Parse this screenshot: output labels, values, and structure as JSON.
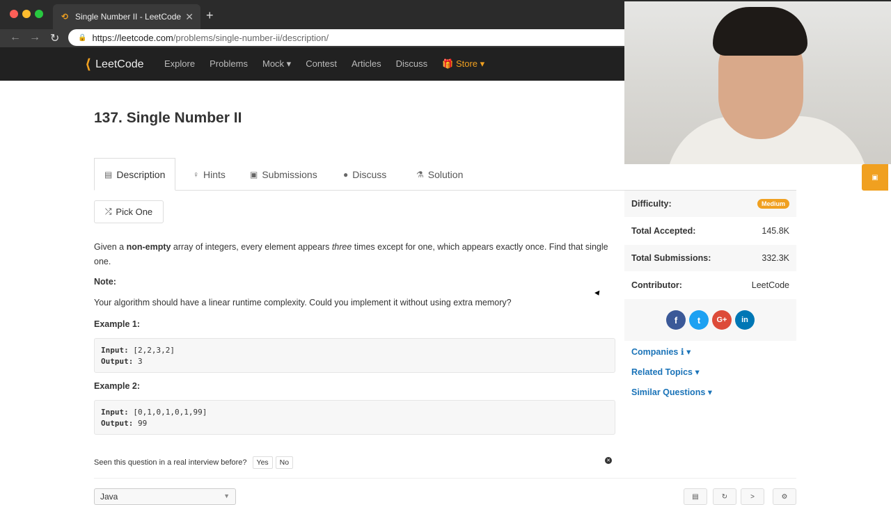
{
  "browser": {
    "tab_title": "Single Number II - LeetCode",
    "url_host": "https://leetcode.com",
    "url_path": "/problems/single-number-ii/description/"
  },
  "site_nav": {
    "logo": "LeetCode",
    "items": [
      {
        "label": "Explore"
      },
      {
        "label": "Problems"
      },
      {
        "label": "Mock ▾"
      },
      {
        "label": "Contest"
      },
      {
        "label": "Articles"
      },
      {
        "label": "Discuss"
      }
    ],
    "store_label": "🎁 Store ▾"
  },
  "problem": {
    "title": "137. Single Number II",
    "tabs": [
      {
        "label": "Description",
        "icon": "description-icon"
      },
      {
        "label": "Hints",
        "icon": "lightbulb-icon"
      },
      {
        "label": "Submissions",
        "icon": "submissions-icon"
      },
      {
        "label": "Discuss",
        "icon": "discuss-icon"
      },
      {
        "label": "Solution",
        "icon": "flask-icon"
      }
    ],
    "pick_one": "Pick One",
    "desc_1": "Given a ",
    "desc_bold": "non-empty",
    "desc_2": " array of integers, every element appears ",
    "desc_italic": "three",
    "desc_3": " times except for one, which appears exactly once. Find that single one.",
    "note_label": "Note:",
    "note_text": "Your algorithm should have a linear runtime complexity. Could you implement it without using extra memory?",
    "example1_label": "Example 1:",
    "example1_input_label": "Input:",
    "example1_input": " [2,2,3,2]",
    "example1_output_label": "Output:",
    "example1_output": " 3",
    "example2_label": "Example 2:",
    "example2_input_label": "Input:",
    "example2_input": " [0,1,0,1,0,1,99]",
    "example2_output_label": "Output:",
    "example2_output": " 99",
    "interview_q": "Seen this question in a real interview before?",
    "yes": "Yes",
    "no": "No",
    "language": "Java"
  },
  "sidebar": {
    "difficulty_label": "Difficulty:",
    "difficulty": "Medium",
    "accepted_label": "Total Accepted:",
    "accepted": "145.8K",
    "submissions_label": "Total Submissions:",
    "submissions": "332.3K",
    "contributor_label": "Contributor:",
    "contributor": "LeetCode",
    "companies": "Companies ℹ ▾",
    "related_topics": "Related Topics ▾",
    "similar_questions": "Similar Questions ▾"
  },
  "colors": {
    "accent": "#f0a020",
    "link": "#1a73b8",
    "nav_bg": "#212121"
  }
}
